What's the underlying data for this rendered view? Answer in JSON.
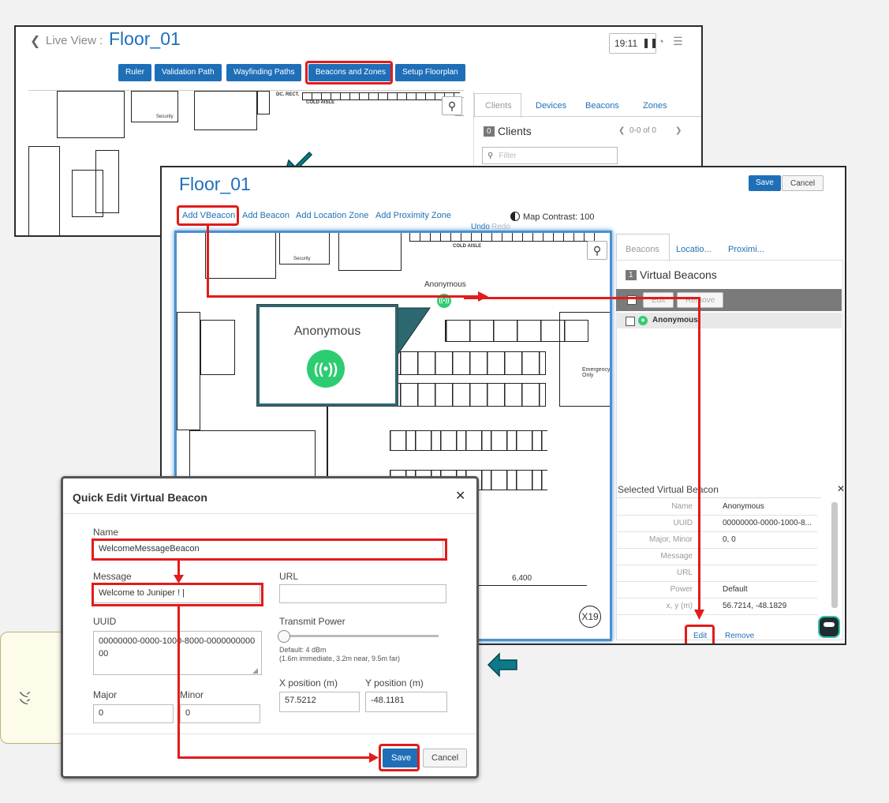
{
  "live_view": {
    "back_label": "Live View :",
    "floor_name": "Floor_01",
    "time": "19:11",
    "pause_icon": "pause-icon",
    "toolbar": [
      "Ruler",
      "Validation Path",
      "Wayfinding Paths",
      "Beacons and Zones",
      "Setup Floorplan"
    ],
    "tabs": [
      "Clients",
      "Devices",
      "Beacons",
      "Zones"
    ],
    "clients_count": "0",
    "clients_label": "Clients",
    "pagination": "0-0 of 0",
    "filter_placeholder": "Filter",
    "plan_labels": {
      "cold_aisle": "COLD AISLE",
      "security": "Security",
      "rect": "DC. RECT."
    }
  },
  "editor": {
    "floor_name": "Floor_01",
    "save_label": "Save",
    "cancel_label": "Cancel",
    "actions": [
      "Add VBeacon",
      "Add Beacon",
      "Add Location Zone",
      "Add Proximity Zone"
    ],
    "undo_label": "Undo",
    "redo_label": "Redo",
    "contrast_label": "Map Contrast: 100",
    "beacon_name": "Anonymous",
    "plan_labels": {
      "cold_aisle": "COLD AISLE",
      "security": "Security",
      "emergency": "Emergency Only",
      "dimension": "6,400",
      "grid_mark": "X19"
    },
    "tabs": [
      "Beacons",
      "Locatio...",
      "Proximi..."
    ],
    "vb_count": "1",
    "vb_label": "Virtual Beacons",
    "list_edit": "Edit",
    "list_remove": "Remove",
    "list_items": [
      "Anonymous"
    ],
    "selected_title": "Selected Virtual Beacon",
    "props": [
      {
        "k": "Name",
        "v": "Anonymous"
      },
      {
        "k": "UUID",
        "v": "00000000-0000-1000-8..."
      },
      {
        "k": "Major, Minor",
        "v": "0, 0"
      },
      {
        "k": "Message",
        "v": ""
      },
      {
        "k": "URL",
        "v": ""
      },
      {
        "k": "Power",
        "v": "Default"
      },
      {
        "k": "x, y (m)",
        "v": "56.7214, -48.1829"
      }
    ],
    "edit_label": "Edit",
    "remove_label": "Remove"
  },
  "callout": {
    "title": "Anonymous"
  },
  "dialog": {
    "title": "Quick Edit Virtual Beacon",
    "name_label": "Name",
    "name_value": "WelcomeMessageBeacon",
    "message_label": "Message",
    "message_value": "Welcome to Juniper ! |",
    "url_label": "URL",
    "url_value": "",
    "uuid_label": "UUID",
    "uuid_value": "00000000-0000-1000-8000-000000000000",
    "power_label": "Transmit Power",
    "power_hint1": "Default: 4 dBm",
    "power_hint2": "(1.6m immediate, 3.2m near, 9.5m far)",
    "major_label": "Major",
    "major_value": "0",
    "minor_label": "Minor",
    "minor_value": "0",
    "x_label": "X position (m)",
    "x_value": "57.5212",
    "y_label": "Y position (m)",
    "y_value": "-48.1181",
    "save_label": "Save",
    "cancel_label": "Cancel"
  },
  "speech_text": "ﾝﾝ",
  "colors": {
    "accent": "#1f6fb8",
    "highlight": "#e21b1b",
    "beacon": "#2ecc71",
    "arrow": "#0d7a8a"
  }
}
